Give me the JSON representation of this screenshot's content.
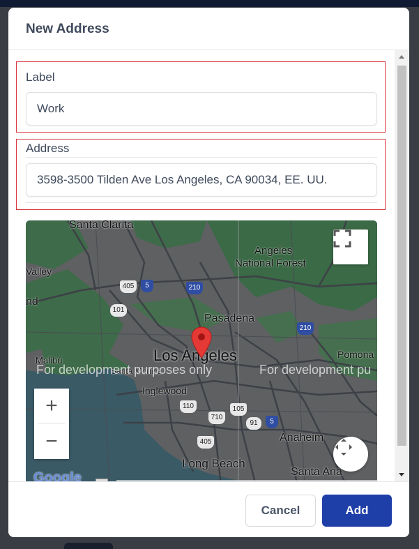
{
  "modal": {
    "title": "New Address"
  },
  "form": {
    "label_field": {
      "label": "Label",
      "value": "Work"
    },
    "address_field": {
      "label": "Address",
      "value": "3598-3500 Tilden Ave Los Angeles, CA 90034, EE. UU."
    }
  },
  "map": {
    "watermark": "For development purposes only",
    "watermark_cut": "For development pu",
    "places": {
      "santa_clarita": "Santa Clarita",
      "angeles_nf_1": "Angeles",
      "angeles_nf_2": "National Forest",
      "valley": "Valley",
      "nd": "nd",
      "pasadena": "Pasadena",
      "los_angeles": "Los Angeles",
      "pomona": "Pomona",
      "malibu": "Malibú",
      "inglewood": "Inglewood",
      "anaheim": "Anaheim",
      "long_beach": "Long Beach",
      "santa_ana": "Santa Ana",
      "santa_monica": "Santa Monica"
    },
    "shields": [
      "405",
      "5",
      "210",
      "101",
      "210",
      "110",
      "710",
      "105",
      "91",
      "5",
      "405"
    ],
    "zoom_in": "+",
    "zoom_out": "−",
    "google_logo": "Google"
  },
  "footer": {
    "cancel_label": "Cancel",
    "add_label": "Add"
  }
}
